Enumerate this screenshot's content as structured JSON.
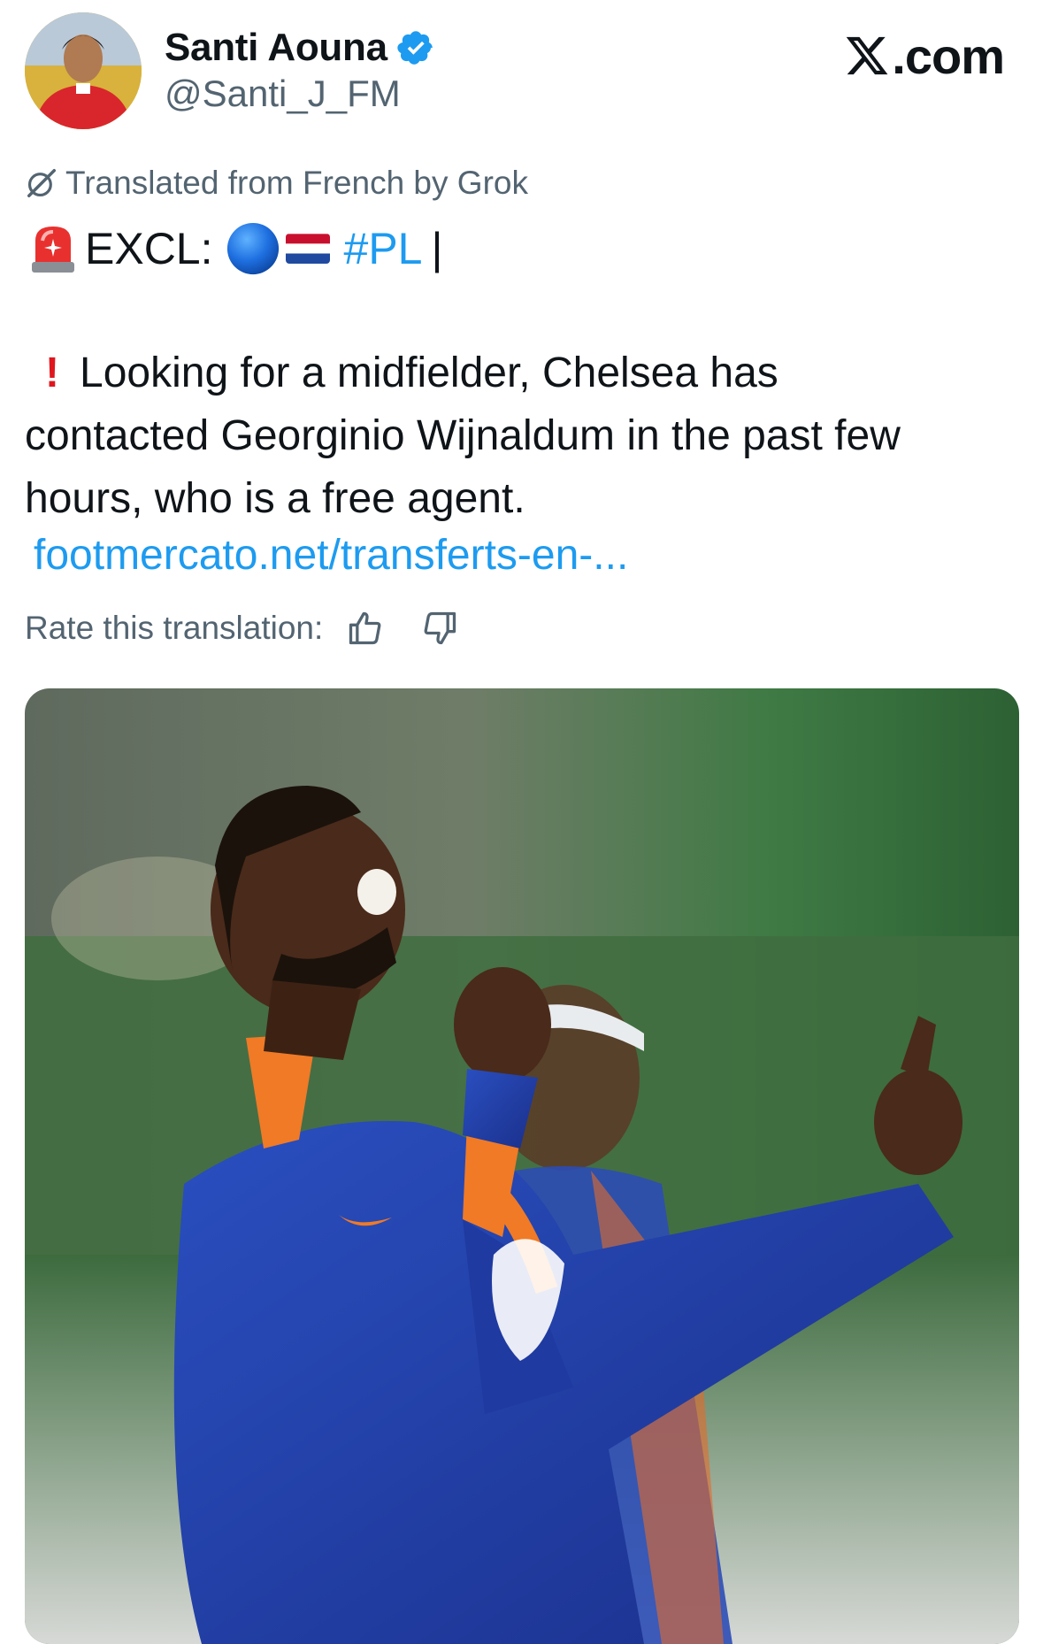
{
  "author": {
    "name": "Santi Aouna",
    "handle": "@Santi_J_FM",
    "verified": true,
    "avatar_icon": "player-avatar"
  },
  "source_badge": {
    "text": ".com",
    "logo_icon": "x-logo-icon"
  },
  "translation_note": "Translated from French by Grok",
  "headline": {
    "prefix": "EXCL:",
    "hashtag": "#PL",
    "suffix": "|",
    "emojis": [
      "siren-icon",
      "blue-circle-icon",
      "netherlands-flag-icon"
    ]
  },
  "body": {
    "line1": "Looking for a midfielder, Chelsea has",
    "line2": "contacted Georginio Wijnaldum in the past few",
    "line3": "hours, who is a free agent."
  },
  "link": "footmercato.net/transferts-en-...",
  "rating": {
    "label": "Rate this translation:",
    "icons": [
      "thumbs-up-icon",
      "thumbs-down-icon"
    ]
  },
  "colors": {
    "link": "#1d9bf0",
    "secondary_text": "#536471",
    "verified": "#1d9bf0",
    "jersey": "#1f3fa6",
    "jersey_accent": "#f36b21"
  }
}
